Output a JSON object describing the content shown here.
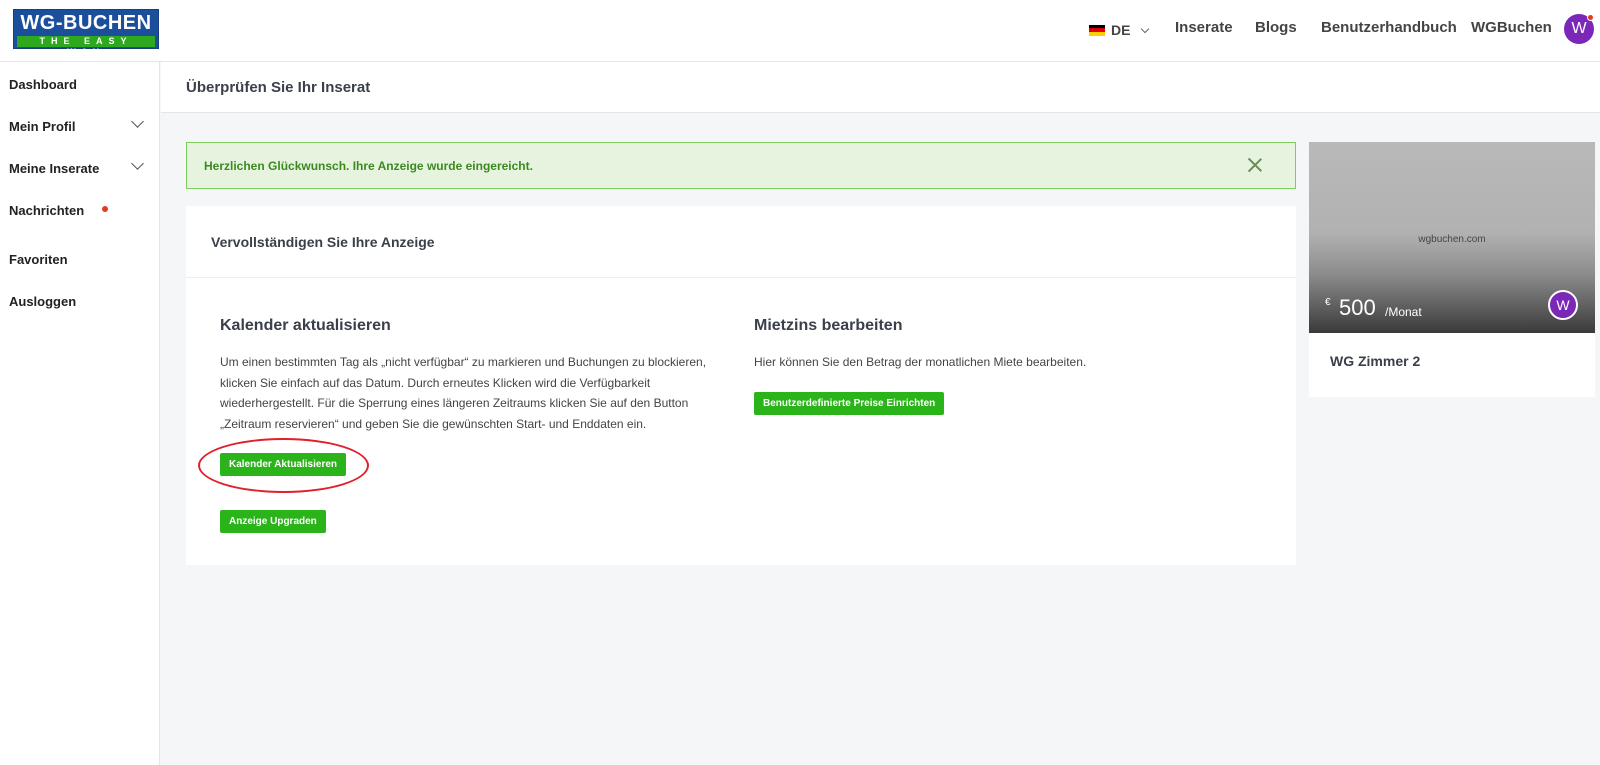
{
  "header": {
    "logo_top": "WG-BUCHEN",
    "logo_bottom": "THE EASY WAY",
    "language": "DE",
    "nav": [
      "Inserate",
      "Blogs",
      "Benutzerhandbuch",
      "WGBuchen"
    ],
    "avatar_letter": "W",
    "flag_colors": [
      "#000000",
      "#dd0000",
      "#ffce00"
    ]
  },
  "sidebar": {
    "items": [
      {
        "label": "Dashboard"
      },
      {
        "label": "Mein Profil"
      },
      {
        "label": "Meine Inserate"
      },
      {
        "label": "Nachrichten"
      },
      {
        "label": "Favoriten"
      },
      {
        "label": "Ausloggen"
      }
    ]
  },
  "page": {
    "title": "Überprüfen Sie Ihr Inserat"
  },
  "alert": {
    "text": "Herzlichen Glückwunsch. Ihre Anzeige wurde eingereicht."
  },
  "card": {
    "title": "Vervollständigen Sie Ihre Anzeige",
    "calendar": {
      "title": "Kalender aktualisieren",
      "lines": [
        "Um einen bestimmten Tag als „nicht verfügbar“ zu markieren und Buchungen zu blockieren,",
        "klicken Sie einfach auf das Datum. Durch erneutes Klicken wird die Verfügbarkeit",
        "wiederhergestellt. Für die Sperrung eines längeren Zeitraums klicken Sie auf den Button",
        "„Zeitraum reservieren“ und geben Sie die gewünschten Start- und Enddaten ein."
      ],
      "button": "Kalender Aktualisieren",
      "upgrade_button": "Anzeige Upgraden"
    },
    "rent": {
      "title": "Mietzins bearbeiten",
      "text": "Hier können Sie den Betrag der monatlichen Miete bearbeiten.",
      "button": "Benutzerdefinierte Preise Einrichten"
    }
  },
  "listing": {
    "watermark": "wgbuchen.com",
    "currency": "€",
    "price": "500",
    "unit": "/Monat",
    "avatar_letter": "W",
    "name": "WG Zimmer 2"
  }
}
